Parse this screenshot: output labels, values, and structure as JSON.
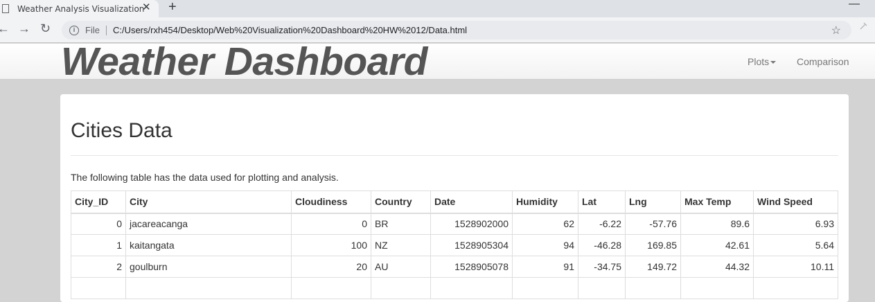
{
  "browser": {
    "tab_title": "Weather Analysis Visualization",
    "close_glyph": "✕",
    "new_tab_glyph": "+",
    "minimize_glyph": "—",
    "back_glyph": "←",
    "forward_glyph": "→",
    "reload_glyph": "↻",
    "info_glyph": "i",
    "scheme_label": "File",
    "url": "C:/Users/rxh454/Desktop/Web%20Visualization%20Dashboard%20HW%2012/Data.html",
    "star_glyph": "☆"
  },
  "navbar": {
    "brand": "Weather Dashboard",
    "plots_label": "Plots",
    "comparison_label": "Comparison"
  },
  "main": {
    "heading": "Cities Data",
    "description": "The following table has the data used for plotting and analysis."
  },
  "table": {
    "columns": [
      "City_ID",
      "City",
      "Cloudiness",
      "Country",
      "Date",
      "Humidity",
      "Lat",
      "Lng",
      "Max Temp",
      "Wind Speed"
    ],
    "rows": [
      [
        "0",
        "jacareacanga",
        "0",
        "BR",
        "1528902000",
        "62",
        "-6.22",
        "-57.76",
        "89.6",
        "6.93"
      ],
      [
        "1",
        "kaitangata",
        "100",
        "NZ",
        "1528905304",
        "94",
        "-46.28",
        "169.85",
        "42.61",
        "5.64"
      ],
      [
        "2",
        "goulburn",
        "20",
        "AU",
        "1528905078",
        "91",
        "-34.75",
        "149.72",
        "44.32",
        "10.11"
      ],
      [
        "",
        "",
        "",
        "",
        "",
        "",
        "",
        "",
        "",
        ""
      ]
    ]
  }
}
